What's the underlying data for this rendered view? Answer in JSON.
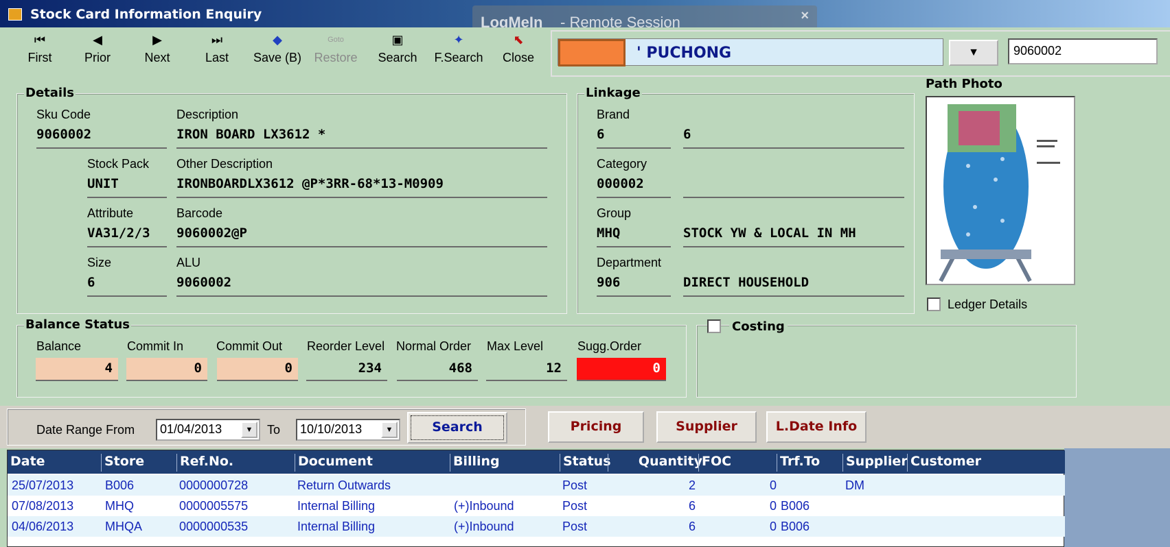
{
  "window": {
    "title": "Stock Card Information Enquiry"
  },
  "overlay": {
    "brand": "LogMeIn",
    "session": "-  Remote Session",
    "close": "×"
  },
  "toolbar": {
    "first": "First",
    "prior": "Prior",
    "next": "Next",
    "last": "Last",
    "save": "Save (B)",
    "restore": "Restore",
    "search": "Search",
    "fsearch": "F.Search",
    "close": "Close",
    "restore_icon_text": "Goto"
  },
  "store": {
    "name": "' PUCHONG",
    "code": "9060002",
    "dropdown": "▼"
  },
  "details": {
    "legend": "Details",
    "sku_label": "Sku Code",
    "sku": "9060002",
    "desc_label": "Description",
    "desc": "IRON BOARD LX3612 *",
    "pack_label": "Stock Pack",
    "pack": "UNIT",
    "other_label": "Other Description",
    "other": "IRONBOARDLX3612 @P*3RR-68*13-M0909",
    "attr_label": "Attribute",
    "attr": "VA31/2/3",
    "barcode_label": "Barcode",
    "barcode": "9060002@P",
    "size_label": "Size",
    "size": "6",
    "alu_label": "ALU",
    "alu": "9060002"
  },
  "linkage": {
    "legend": "Linkage",
    "brand_label": "Brand",
    "brand_code": "6",
    "brand_name": "6",
    "category_label": "Category",
    "category_code": "000002",
    "category_name": "",
    "group_label": "Group",
    "group_code": "MHQ",
    "group_name": "STOCK YW & LOCAL IN MH",
    "dept_label": "Department",
    "dept_code": "906",
    "dept_name": "DIRECT HOUSEHOLD"
  },
  "photo": {
    "title": "Path Photo",
    "ledger_label": "Ledger Details"
  },
  "balance": {
    "legend": "Balance Status",
    "labels": [
      "Balance",
      "Commit In",
      "Commit Out",
      "Reorder Level",
      "Normal Order",
      "Max Level",
      "Sugg.Order"
    ],
    "values": [
      "4",
      "0",
      "0",
      "234",
      "468",
      "12",
      "0"
    ]
  },
  "costing": {
    "label": "Costing"
  },
  "range": {
    "from_label": "Date Range From",
    "from": "01/04/2013",
    "to_label": "To",
    "to": "10/10/2013",
    "search": "Search",
    "pricing": "Pricing",
    "supplier": "Supplier",
    "ldate": "L.Date Info"
  },
  "table": {
    "headers": [
      "Date",
      "Store",
      "Ref.No.",
      "Document",
      "Billing",
      "Status",
      "Quantity",
      "FOC",
      "Trf.To",
      "Supplier",
      "Customer"
    ],
    "rows": [
      [
        "25/07/2013",
        "B006",
        "0000000728",
        "Return Outwards",
        "",
        "Post",
        "2",
        "0",
        "",
        "DM",
        ""
      ],
      [
        "07/08/2013",
        "MHQ",
        "0000005575",
        "Internal Billing",
        "(+)Inbound",
        "Post",
        "6",
        "0",
        "B006",
        "",
        ""
      ],
      [
        "04/06/2013",
        "MHQA",
        "0000000535",
        "Internal Billing",
        "(+)Inbound",
        "Post",
        "6",
        "0",
        "B006",
        "",
        ""
      ]
    ]
  },
  "colors": {
    "background": "#bcd7bc",
    "peach": "#f4cdb0",
    "alert": "#ff1010",
    "grid_header": "#1f3f73",
    "grid_text": "#1426b8"
  }
}
